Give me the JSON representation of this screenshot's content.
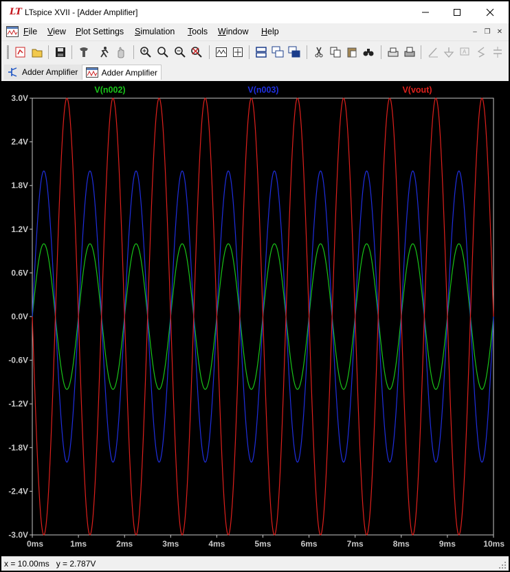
{
  "window": {
    "title": "LTspice XVII - [Adder Amplifier]",
    "logo": "LT"
  },
  "menu": {
    "items": [
      {
        "key": "F",
        "rest": "ile"
      },
      {
        "key": "V",
        "rest": "iew"
      },
      {
        "key": "P",
        "rest": "lot Settings"
      },
      {
        "key": "S",
        "rest": "imulation"
      },
      {
        "key": "T",
        "rest": "ools"
      },
      {
        "key": "W",
        "rest": "indow"
      },
      {
        "key": "H",
        "rest": "elp"
      }
    ]
  },
  "toolbar": {
    "icons": [
      "open-schematic-icon",
      "open-file-icon",
      "save-icon",
      "control-panel-icon",
      "run-icon",
      "pan-icon",
      "zoom-in-icon",
      "zoom-out-icon",
      "zoom-fit-icon",
      "zoom-cancel-icon",
      "autorange-icon",
      "add-trace-icon",
      "tile-horizontal-icon",
      "cascade-icon",
      "tile-vertical-icon",
      "cut-icon",
      "copy-icon",
      "paste-icon",
      "find-icon",
      "print-preview-icon",
      "print-icon",
      "wire-icon",
      "ground-icon",
      "label-icon",
      "resistor-icon",
      "capacitor-icon"
    ]
  },
  "tabs": [
    {
      "label": "Adder Amplifier",
      "icon": "schematic-icon"
    },
    {
      "label": "Adder Amplifier",
      "icon": "waveform-icon"
    }
  ],
  "status": {
    "text": "x = 10.00ms   y = 2.787V"
  },
  "colors": {
    "plot_background": "#000000",
    "axis": "#c8c8c8",
    "n002": "#19c419",
    "n003": "#1f2fe0",
    "vout": "#e0201c"
  },
  "chart_data": {
    "type": "line",
    "title": "",
    "xlabel": "",
    "ylabel": "",
    "x_ticks": [
      "0ms",
      "1ms",
      "2ms",
      "3ms",
      "4ms",
      "5ms",
      "6ms",
      "7ms",
      "8ms",
      "9ms",
      "10ms"
    ],
    "y_ticks": [
      "3.0V",
      "2.4V",
      "1.8V",
      "1.2V",
      "0.6V",
      "0.0V",
      "-0.6V",
      "-1.2V",
      "-1.8V",
      "-2.4V",
      "-3.0V"
    ],
    "xlim": [
      0,
      10
    ],
    "ylim": [
      -3.0,
      3.0
    ],
    "x_unit": "ms",
    "grid": false,
    "legend": "top",
    "series": [
      {
        "name": "V(n002)",
        "amplitude": 1.0,
        "frequency_khz": 1.0,
        "phase": "sine",
        "color": "#19c419"
      },
      {
        "name": "V(n003)",
        "amplitude": 2.0,
        "frequency_khz": 1.0,
        "phase": "sine",
        "color": "#1f2fe0"
      },
      {
        "name": "V(vout)",
        "amplitude": 3.0,
        "frequency_khz": 1.0,
        "phase": "negative-sine",
        "color": "#e0201c"
      }
    ]
  }
}
